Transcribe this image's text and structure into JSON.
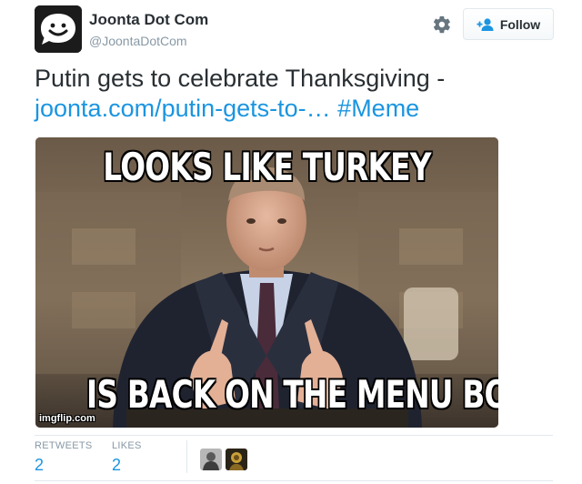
{
  "author": {
    "name": "Joonta Dot Com",
    "handle": "@JoontaDotCom",
    "avatar_icon": "smiley-chat-bubble-icon"
  },
  "actions": {
    "settings_icon": "gear-icon",
    "follow_label": "Follow",
    "follow_icon": "add-user-icon"
  },
  "tweet": {
    "text": "Putin gets to celebrate Thanksgiving -",
    "link_text": "joonta.com/putin-gets-to-…",
    "hashtag": "#Meme"
  },
  "media": {
    "top_caption": "LOOKS LIKE TURKEY",
    "bottom_caption": "IS BACK ON THE MENU BOYS",
    "watermark": "imgflip.com"
  },
  "stats": {
    "retweets_label": "RETWEETS",
    "retweets_value": "2",
    "likes_label": "LIKES",
    "likes_value": "2"
  },
  "colors": {
    "link": "#1b95e0",
    "text": "#292f33",
    "muted": "#8899a6",
    "border": "#e1e8ed"
  }
}
